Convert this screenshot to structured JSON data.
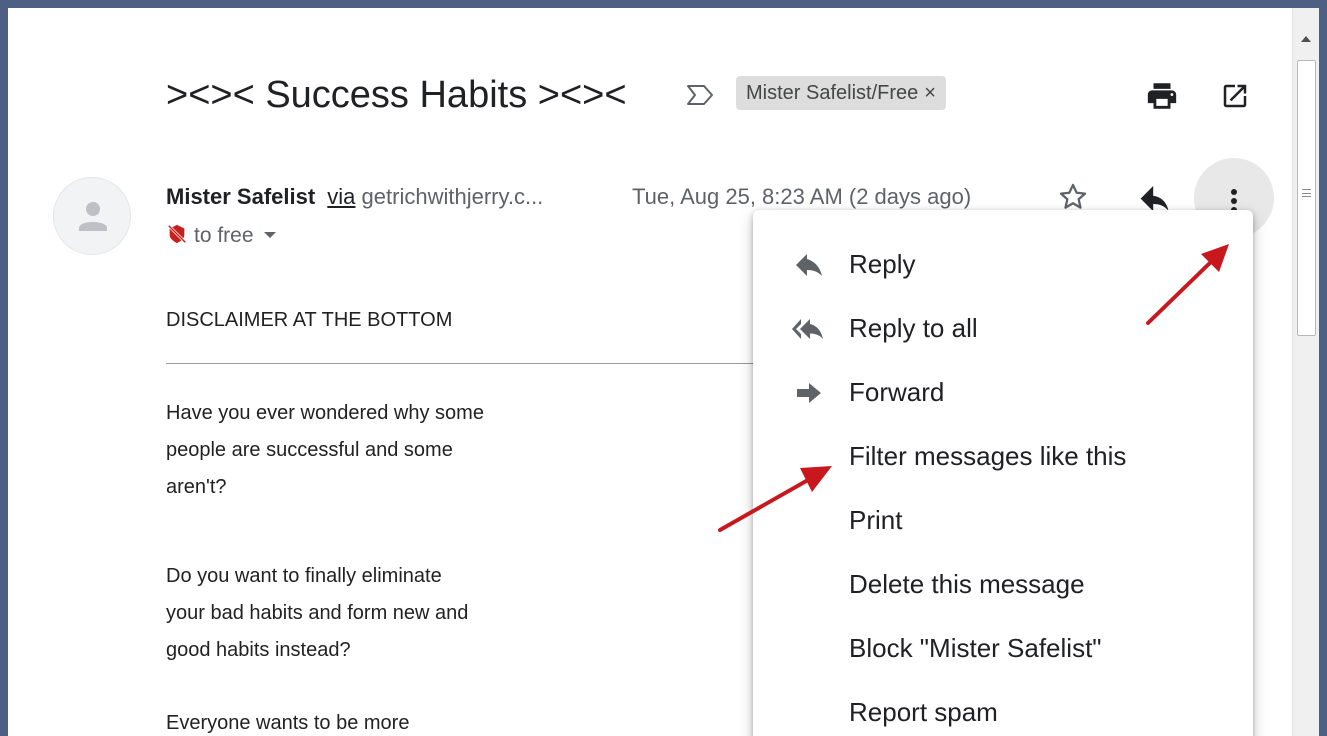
{
  "subject": {
    "title": "><>< Success Habits ><><",
    "label_chip": "Mister Safelist/Free",
    "label_remove": "×"
  },
  "message": {
    "sender_name": "Mister Safelist",
    "via_text": "via",
    "via_domain": "getrichwithjerry.c...",
    "date": "Tue, Aug 25, 8:23 AM (2 days ago)",
    "recipient": "to free"
  },
  "body": {
    "disclaimer": "DISCLAIMER AT THE BOTTOM",
    "paragraph1": [
      "Have you ever wondered why some",
      "people are successful and some",
      "aren't?"
    ],
    "paragraph2": [
      "Do you want to finally eliminate",
      "your bad habits and form new and",
      "good habits instead?"
    ],
    "paragraph3": [
      "Everyone wants to be more"
    ]
  },
  "menu": {
    "items": [
      {
        "label": "Reply",
        "icon": "reply-icon"
      },
      {
        "label": "Reply to all",
        "icon": "reply-all-icon"
      },
      {
        "label": "Forward",
        "icon": "forward-icon"
      },
      {
        "label": "Filter messages like this",
        "icon": ""
      },
      {
        "label": "Print",
        "icon": ""
      },
      {
        "label": "Delete this message",
        "icon": ""
      },
      {
        "label": "Block \"Mister Safelist\"",
        "icon": ""
      },
      {
        "label": "Report spam",
        "icon": ""
      }
    ]
  },
  "colors": {
    "outer_frame": "#4d6084",
    "arrow_red": "#c8181e",
    "label_chip_bg": "#dddddd",
    "more_button_bg": "#e8e8e8",
    "unsecure_icon": "#c5221f"
  }
}
